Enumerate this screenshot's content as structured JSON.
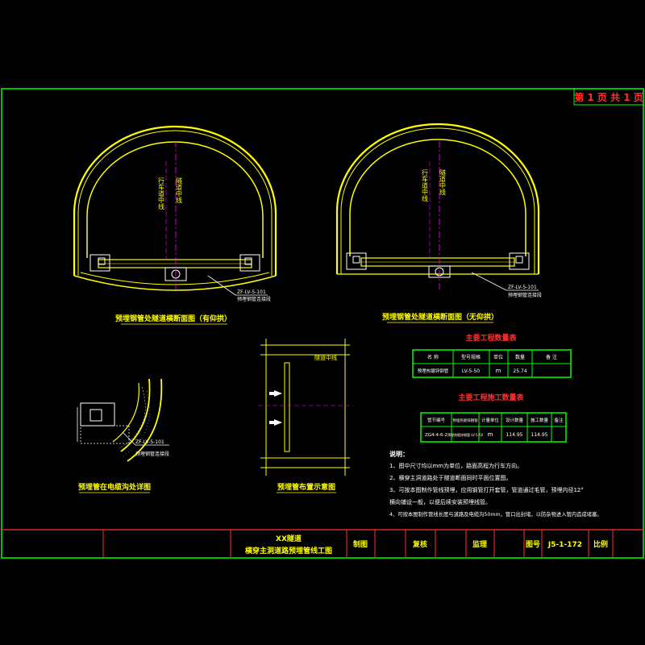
{
  "page_counter": "第 1 页 共 1 页",
  "section_left": {
    "title": "预埋钢管处隧道横断面图（有仰拱）",
    "vertical_label_1": "行车道中线",
    "vertical_label_2": "隧道中线",
    "pipe_label": "ZF-LV-5-101",
    "pipe_sublabel": "预埋钢管连接段"
  },
  "section_right": {
    "title": "预埋钢管处隧道横断面图（无仰拱）",
    "vertical_label_1": "行车道中线",
    "vertical_label_2": "隧道中线",
    "pipe_label": "ZF-LV-5-101",
    "pipe_sublabel": "预埋钢管连接段"
  },
  "detail_left": {
    "title": "预埋管在电缆沟处详图",
    "pipe_label": "ZF-LV-5-101",
    "pipe_sublabel": "预埋钢管连接段"
  },
  "detail_plan": {
    "title": "预埋管布置示意图",
    "label": "隧道中线"
  },
  "table1": {
    "title": "主要工程数量表",
    "headers": [
      "名  称",
      "型号规格",
      "单位",
      "数量",
      "备  注"
    ],
    "row": [
      "预埋热镀锌钢管",
      "LV-5-50",
      "m",
      "25.74",
      ""
    ]
  },
  "table2": {
    "title": "主要工程施工数量表",
    "headers": [
      "管节编号",
      "预埋热镀锌钢管",
      "计量单位",
      "设计数量",
      "施工数量",
      "备注"
    ],
    "row": [
      "ZG4-4-6-2",
      "预埋热镀锌钢管 LV-5-50",
      "m",
      "114.95",
      "114.95",
      ""
    ]
  },
  "notes": {
    "heading": "说明：",
    "items": [
      "1、图中尺寸均以mm为单位，路面高程为行车方向。",
      "2、横穿主洞道路处于隧道断面同时平面位置图。",
      "3、可按本图制作管线预埋，应用钢管打开套管，管道通过毛管，预埋内径12°",
      "   横向铺设一般，以便后续安装预埋线管。",
      "4、可按本图制作管线长度与道路及电缆沟50mm，管口出封堵，以防杂物进入管内造成堵塞。"
    ]
  },
  "title_block": {
    "project": "XX隧道",
    "drawing_name": "横穿主洞道路预埋管线工图",
    "draw_label": "制图",
    "review_label": "复核",
    "supervise_label": "监理",
    "drawing_no_label": "图号",
    "drawing_no": "J5-1-172",
    "scale_label": "比例"
  },
  "colors": {
    "frame": "#00ff00",
    "lining": "#ffff00",
    "text_yellow": "#ffff00",
    "text_red": "#ff3030",
    "accent_magenta": "#ff00ff",
    "cyan": "#00ffff",
    "white": "#ffffff"
  }
}
